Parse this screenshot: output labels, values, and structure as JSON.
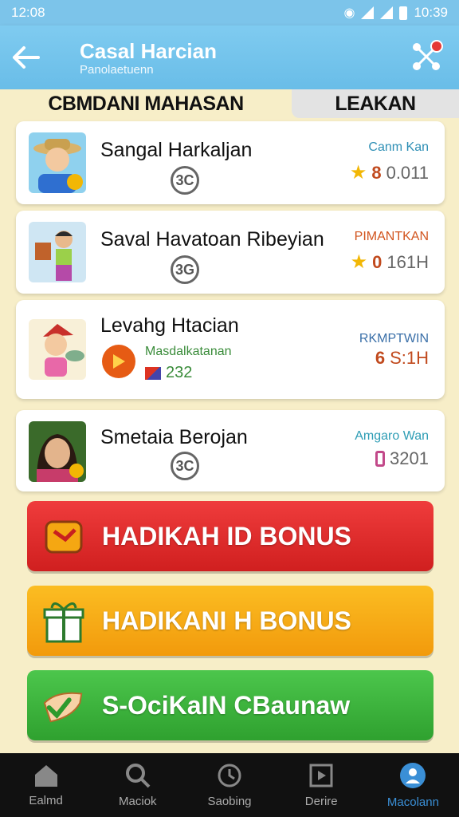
{
  "status_bar": {
    "left_time": "12:08",
    "right_time": "10:39"
  },
  "app_bar": {
    "title": "Casal Harcian",
    "subtitle": "Panolaetuenn"
  },
  "tabs": [
    {
      "label": "CBMDANI MAHASAN",
      "active": true
    },
    {
      "label": "LEAKAN",
      "active": false
    }
  ],
  "list": [
    {
      "title": "Sangal Harkaljan",
      "circle": "3C",
      "side_label": "Canm Kan",
      "side_label_color": "#2e8fb5",
      "value_prefix": "8",
      "value": "0.011",
      "icon": "star-icon"
    },
    {
      "title": "Saval Havatoan Ribeyian",
      "circle": "3G",
      "side_label": "PIMANTKAN",
      "side_label_color": "#d2551f",
      "value_prefix": "0",
      "value": "161H",
      "icon": "star-icon"
    },
    {
      "title": "Levahg Htacian",
      "sub_label": "Masdalkatanan",
      "sub_value": "232",
      "side_label": "RKMPTWIN",
      "side_label_color": "#3a6fa8",
      "value_prefix": "6",
      "value": "S:1H"
    },
    {
      "title": "Smetaia Berojan",
      "circle": "3C",
      "side_label": "Amgaro Wan",
      "side_label_color": "#2e9db5",
      "value_prefix": "",
      "value": "3201",
      "icon": "tag-icon"
    }
  ],
  "buttons": [
    {
      "label": "HADIKAH ID BONUS",
      "color": "#e02b2b",
      "icon": "wallet-icon"
    },
    {
      "label": "HADIKANI H BONUS",
      "color": "#f5a712",
      "icon": "gift-icon"
    },
    {
      "label": "S-OciKaIN CBaunaw",
      "color": "#3fb53f",
      "icon": "check-hand-icon"
    }
  ],
  "nav": [
    {
      "label": "Ealmd",
      "icon": "home-icon"
    },
    {
      "label": "Maciok",
      "icon": "search-icon"
    },
    {
      "label": "Saobing",
      "icon": "clock-icon"
    },
    {
      "label": "Derire",
      "icon": "screen-icon"
    },
    {
      "label": "Macolann",
      "icon": "profile-icon",
      "active": true
    }
  ]
}
